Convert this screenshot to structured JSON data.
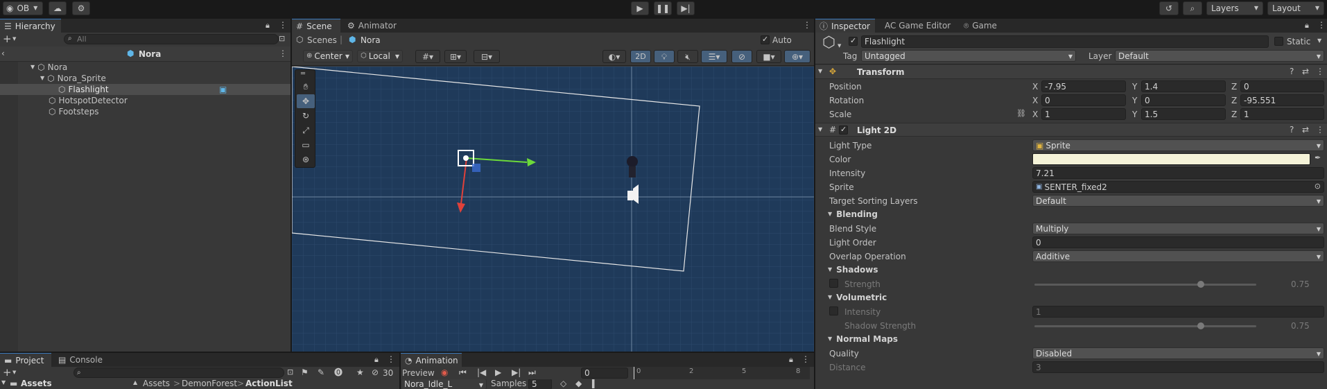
{
  "topbar": {
    "account": "OB",
    "layers_label": "Layers",
    "layout_label": "Layout"
  },
  "hierarchy": {
    "tab_label": "Hierarchy",
    "search_placeholder": "All",
    "scene_name": "Nora",
    "items": [
      {
        "label": "Nora"
      },
      {
        "label": "Nora_Sprite"
      },
      {
        "label": "Flashlight"
      },
      {
        "label": "HotspotDetector"
      },
      {
        "label": "Footsteps"
      }
    ]
  },
  "scene": {
    "tabs": [
      "Scene",
      "Animator"
    ],
    "breadcrumb_root": "Scenes",
    "breadcrumb_current": "Nora",
    "auto_save_label": "Auto Save",
    "pivot_label": "Center",
    "space_label": "Local",
    "mode_2d_label": "2D"
  },
  "bottom_left": {
    "tabs": [
      "Project",
      "Console"
    ],
    "hidden_count": "30",
    "assets_label": "Assets",
    "breadcrumb": [
      "Assets",
      "DemonForest",
      "ActionList"
    ]
  },
  "animation": {
    "tab_label": "Animation",
    "preview_label": "Preview",
    "frame_value": "0",
    "clip_name": "Nora_Idle_L",
    "samples_label": "Samples",
    "samples_value": "5",
    "ruler_ticks": [
      "0",
      "2",
      "5",
      "8"
    ]
  },
  "inspector": {
    "tabs": [
      "Inspector",
      "AC Game Editor",
      "Game"
    ],
    "object_name": "Flashlight",
    "static_label": "Static",
    "tag_label": "Tag",
    "tag_value": "Untagged",
    "layer_label": "Layer",
    "layer_value": "Default",
    "transform": {
      "title": "Transform",
      "position_label": "Position",
      "rotation_label": "Rotation",
      "scale_label": "Scale",
      "position": {
        "x": "-7.95",
        "y": "1.4",
        "z": "0"
      },
      "rotation": {
        "x": "0",
        "y": "0",
        "z": "-95.551"
      },
      "scale": {
        "x": "1",
        "y": "1.5",
        "z": "1"
      }
    },
    "light2d": {
      "title": "Light 2D",
      "light_type_label": "Light Type",
      "light_type_value": "Sprite",
      "color_label": "Color",
      "color_value": "#f5f3d8",
      "intensity_label": "Intensity",
      "intensity_value": "7.21",
      "sprite_label": "Sprite",
      "sprite_value": "SENTER_fixed2",
      "sorting_label": "Target Sorting Layers",
      "sorting_value": "Default",
      "blending_head": "Blending",
      "blend_style_label": "Blend Style",
      "blend_style_value": "Multiply",
      "light_order_label": "Light Order",
      "light_order_value": "0",
      "overlap_label": "Overlap Operation",
      "overlap_value": "Additive",
      "shadows_head": "Shadows",
      "shadow_strength_label": "Strength",
      "shadow_strength_value": "0.75",
      "shadow_strength_fraction": 0.75,
      "volumetric_head": "Volumetric",
      "vol_intensity_label": "Intensity",
      "vol_intensity_value": "1",
      "vol_shadow_label": "Shadow Strength",
      "vol_shadow_value": "0.75",
      "vol_shadow_fraction": 0.75,
      "normal_maps_head": "Normal Maps",
      "quality_label": "Quality",
      "quality_value": "Disabled",
      "distance_label": "Distance",
      "distance_value": "3"
    }
  },
  "colors": {
    "accent": "#3a79bb",
    "scene_bg": "#1f3a5a",
    "gizmo_x": "#e0413a",
    "gizmo_y": "#6cd93a"
  }
}
